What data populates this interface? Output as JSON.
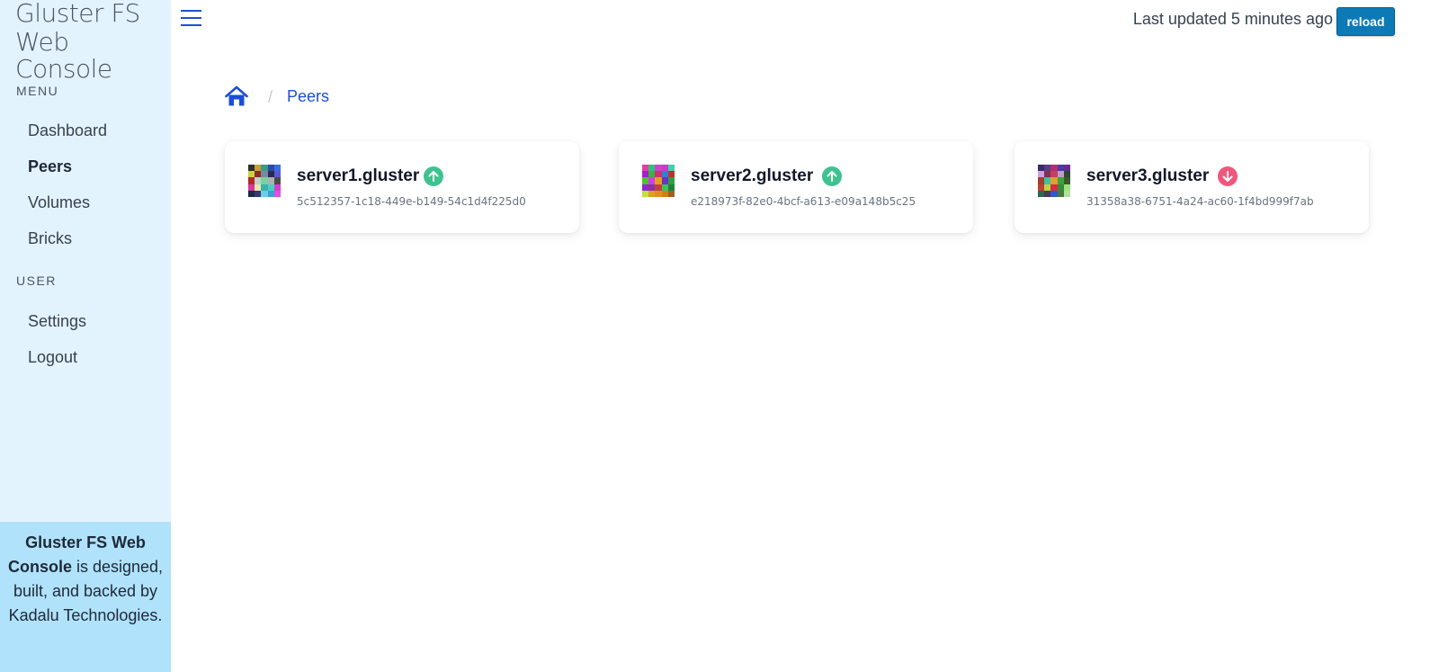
{
  "brand": {
    "line1": "Gluster FS",
    "line2": "Web Console"
  },
  "sidebar": {
    "menu_label": "MENU",
    "menu_items": [
      {
        "label": "Dashboard",
        "active": false
      },
      {
        "label": "Peers",
        "active": true
      },
      {
        "label": "Volumes",
        "active": false
      },
      {
        "label": "Bricks",
        "active": false
      }
    ],
    "user_label": "USER",
    "user_items": [
      {
        "label": "Settings"
      },
      {
        "label": "Logout"
      }
    ],
    "footer": {
      "brand": "Gluster FS Web Console",
      "text_rest": " is designed, built, and backed by Kadalu Technologies."
    }
  },
  "topbar": {
    "status_text": "Last updated 5 minutes ago",
    "reload_label": "reload"
  },
  "breadcrumb": {
    "separator": "/",
    "current": "Peers"
  },
  "peers": [
    {
      "name": "server1.gluster",
      "id": "5c512357-1c18-449e-b149-54c1d4f225d0",
      "state": "up"
    },
    {
      "name": "server2.gluster",
      "id": "e218973f-82e0-4bcf-a613-e09a148b5c25",
      "state": "up"
    },
    {
      "name": "server3.gluster",
      "id": "31358a38-6751-4a24-ac60-1f4bd999f7ab",
      "state": "down"
    }
  ],
  "colors": {
    "sidebar_bg": "#e3f3fd",
    "footer_bg": "#b0e2fb",
    "accent": "#1d4ed8",
    "reload_bg": "#0d7ab8",
    "status_up": "#3ec28f",
    "status_down": "#f0577d"
  }
}
